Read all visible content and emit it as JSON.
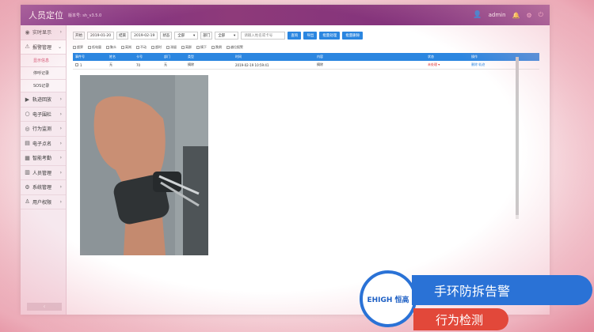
{
  "header": {
    "title": "人员定位",
    "version": "版本号: sh_v3.5.0",
    "username": "admin"
  },
  "sidebar": {
    "items": [
      {
        "label": "实时显示",
        "icon": "eye-icon",
        "chev": "›"
      },
      {
        "label": "报警管理",
        "icon": "alarm-bell-icon",
        "chev": "⌄"
      },
      {
        "label": "轨迹回放",
        "icon": "play-icon",
        "chev": "›"
      },
      {
        "label": "电子围栏",
        "icon": "circle-icon",
        "chev": "›"
      },
      {
        "label": "行为监测",
        "icon": "activity-icon",
        "chev": "›"
      },
      {
        "label": "电子点名",
        "icon": "rollcall-icon",
        "chev": "›"
      },
      {
        "label": "智能考勤",
        "icon": "calendar-icon",
        "chev": "›"
      },
      {
        "label": "人员管理",
        "icon": "people-icon",
        "chev": "›"
      },
      {
        "label": "系统管理",
        "icon": "gear-icon",
        "chev": "›"
      },
      {
        "label": "用户权限",
        "icon": "user-icon",
        "chev": "›"
      }
    ],
    "sub_items": [
      "显示信息",
      "停呼记录",
      "SOS记录"
    ],
    "collapse_label": "‹"
  },
  "toolbar": {
    "start_label": "开始",
    "start_date": "2019-01-20",
    "end_label": "结束",
    "end_date": "2019-02-19",
    "status_label": "状态",
    "status_value": "全部",
    "dept_label": "部门",
    "dept_value": "全部",
    "search_placeholder": "请输入姓名或卡号",
    "buttons": [
      "查询",
      "导出",
      "批量处理",
      "批量删除"
    ]
  },
  "filters": [
    "超界",
    "低电量",
    "聚众",
    "离岗",
    "不动",
    "超时",
    "滞留",
    "离群",
    "摘下",
    "跌倒",
    "越位报警"
  ],
  "table": {
    "columns": [
      "事件号",
      "姓名",
      "卡号",
      "部门",
      "类型",
      "时间",
      "内容",
      "状态",
      "操作"
    ],
    "rows": [
      {
        "id": "1",
        "name": "无",
        "card": "70",
        "dept": "无",
        "type": "摘除",
        "time": "2019-02-19 10:59:41",
        "content": "摘除",
        "status": "未处理 ▾",
        "ops": "删除 轨迹"
      }
    ]
  },
  "captions": {
    "brand": "EHIGH 恒高",
    "line1": "手环防拆告警",
    "line2": "行为检测"
  },
  "colors": {
    "header": "#7b2f86",
    "table_header": "#2b86e0",
    "caption_blue": "#2a72d6",
    "caption_red": "#e2483a"
  }
}
